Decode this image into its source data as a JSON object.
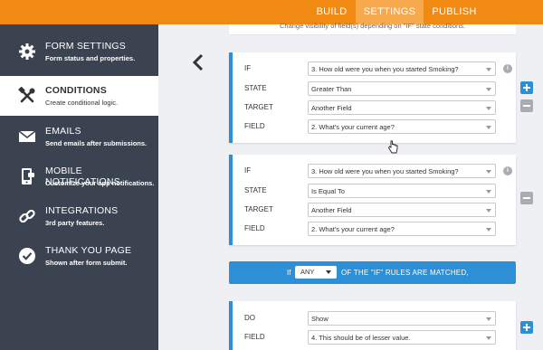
{
  "topbar": {
    "tabs": [
      {
        "label": "BUILD"
      },
      {
        "label": "SETTINGS"
      },
      {
        "label": "PUBLISH"
      }
    ],
    "active_color": "#f6a94d",
    "bar_color": "#f08a12"
  },
  "sidebar": {
    "items": [
      {
        "title": "FORM SETTINGS",
        "subtitle": "Form status and properties.",
        "icon": "gear-icon"
      },
      {
        "title": "CONDITIONS",
        "subtitle": "Create conditional logic.",
        "icon": "tools-icon"
      },
      {
        "title": "EMAILS",
        "subtitle": "Send emails after submissions.",
        "icon": "envelope-icon"
      },
      {
        "title": "MOBILE NOTIFICATIONS",
        "subtitle": "Customize your app notifications.",
        "icon": "mobile-icon"
      },
      {
        "title": "INTEGRATIONS",
        "subtitle": "3rd party features.",
        "icon": "link-icon"
      },
      {
        "title": "THANK YOU PAGE",
        "subtitle": "Shown after form submit.",
        "icon": "check-circle-icon"
      }
    ],
    "active_index": 1
  },
  "main": {
    "description": "Change visibility of field(s) depending on \"IF\" state conditions.",
    "rules": [
      {
        "if_label": "IF",
        "if_value": "3. How old were you when you started Smoking?",
        "state_label": "STATE",
        "state_value": "Greater Than",
        "target_label": "TARGET",
        "target_value": "Another Field",
        "field_label": "FIELD",
        "field_value": "2. What's your current age?"
      },
      {
        "if_label": "IF",
        "if_value": "3. How old were you when you started Smoking?",
        "state_label": "STATE",
        "state_value": "Is Equal To",
        "target_label": "TARGET",
        "target_value": "Another Field",
        "field_label": "FIELD",
        "field_value": "2. What's your current age?"
      }
    ],
    "match": {
      "prefix": "If",
      "selector_value": "ANY",
      "suffix": "OF THE \"IF\" RULES ARE MATCHED,"
    },
    "action": {
      "do_label": "DO",
      "do_value": "Show",
      "field_label": "FIELD",
      "field_value": "4. This should be of lesser value."
    }
  }
}
